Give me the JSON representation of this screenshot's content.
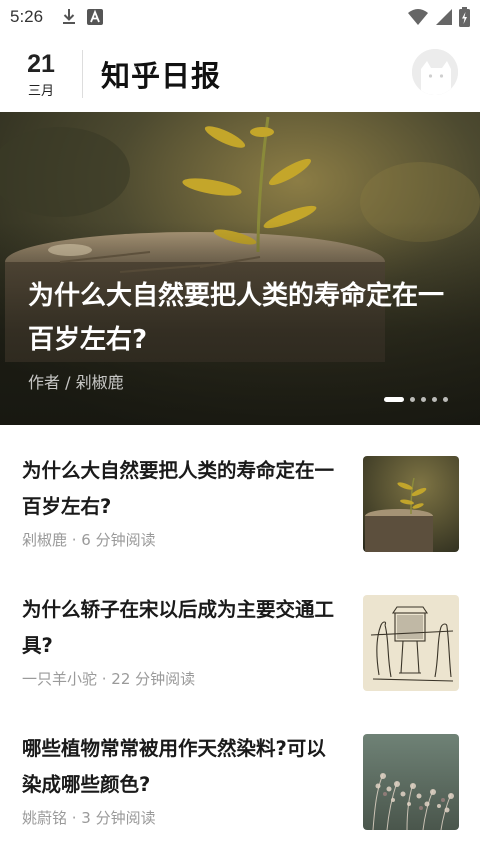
{
  "status_bar": {
    "time": "5:26",
    "icons": [
      "download-icon",
      "a-notification-icon",
      "wifi-icon",
      "signal-icon",
      "battery-charging-icon"
    ]
  },
  "header": {
    "day": "21",
    "month": "三月",
    "title": "知乎日报",
    "avatar_icon": "avatar-placeholder-icon"
  },
  "hero": {
    "title": "为什么大自然要把人类的寿命定在一百岁左右?",
    "author": "作者 / 剁椒鹿",
    "page_count": 5,
    "active_page": 1,
    "colors": {
      "overlay": "#2b2a1f",
      "title": "#ffffff"
    }
  },
  "feed": {
    "items": [
      {
        "title": "为什么大自然要把人类的寿命定在一百岁左右?",
        "meta": "剁椒鹿 · 6 分钟阅读",
        "thumb": "plant-on-stump-image"
      },
      {
        "title": "为什么轿子在宋以后成为主要交通工具?",
        "meta": "一只羊小驼 · 22 分钟阅读",
        "thumb": "sedan-chair-sketch-image"
      },
      {
        "title": "哪些植物常常被用作天然染料?可以染成哪些颜色?",
        "meta": "姚蔚铭 · 3 分钟阅读",
        "thumb": "wild-plants-image"
      }
    ]
  }
}
